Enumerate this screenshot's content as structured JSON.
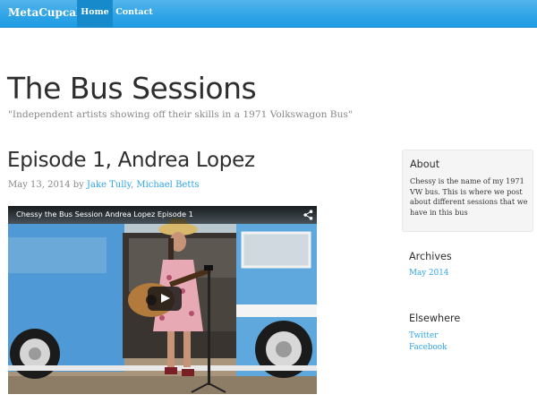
{
  "navbar": {
    "brand": "MetaCupcake",
    "items": [
      {
        "label": "Home",
        "active": true
      },
      {
        "label": "Contact",
        "active": false
      }
    ],
    "color": "#2fa4e7"
  },
  "site": {
    "title": "The Bus Sessions",
    "tagline": "\"Independent artists showing off their skills in a 1971 Volkswagon Bus\""
  },
  "post": {
    "title": "Episode 1, Andrea Lopez",
    "date": "May 13, 2014",
    "by": "by",
    "authors": [
      "Jake Tully",
      "Michael Betts"
    ],
    "video": {
      "title": "Chessy the Bus Session Andrea Lopez Episode 1",
      "share_icon": "share-icon",
      "play_icon": "play-icon"
    }
  },
  "sidebar": {
    "about": {
      "heading": "About",
      "text": "Chessy is the name of my 1971 VW bus. This is where we post about different sessions that we have in this bus"
    },
    "archives": {
      "heading": "Archives",
      "links": [
        "May 2014"
      ]
    },
    "elsewhere": {
      "heading": "Elsewhere",
      "links": [
        "Twitter",
        "Facebook"
      ]
    }
  },
  "colors": {
    "link": "#2fa4e7",
    "bus_blue": "#5ea8dd"
  }
}
